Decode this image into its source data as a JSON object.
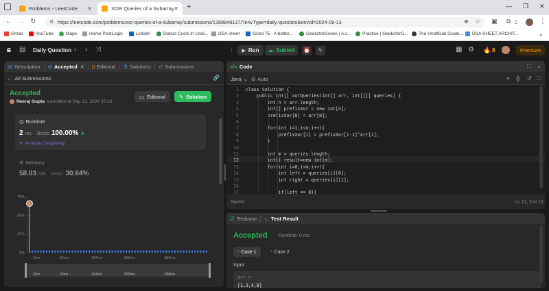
{
  "browser": {
    "tabs": [
      {
        "label": "Problems - LeetCode"
      },
      {
        "label": "XOR Queries of a Subarray - Le"
      }
    ],
    "url": "https://leetcode.com/problems/xor-queries-of-a-subarray/submissions/1388848137/?envType=daily-question&envId=2024-09-13",
    "bookmarks": [
      "Gmail",
      "YouTube",
      "Maps",
      "Home PostLogin",
      "Linkdin",
      "Detect Cycle In Undi...",
      "DSA sheet",
      "Grind 75 - A better...",
      "GeeksforGeeks | A c...",
      "Practice | GeeksforG...",
      "The Unofficial Guide...",
      "DSA SHEET ARCHIT..."
    ]
  },
  "lcnav": {
    "daily": "Daily Question",
    "run": "Run",
    "submit": "Submit",
    "streak": "8",
    "premium": "Premium"
  },
  "left": {
    "tabs": [
      "Description",
      "Accepted",
      "Editorial",
      "Solutions",
      "Submissions"
    ],
    "all_submissions": "All Submissions",
    "status": "Accepted",
    "user": "Neeraj Gupta",
    "submitted_at": "submitted at Sep 13, 2024 20:10",
    "editorial_btn": "Editorial",
    "solution_btn": "Solution",
    "runtime_label": "Runtime",
    "runtime_value": "2",
    "runtime_unit": "ms",
    "beats_label": "Beats",
    "runtime_beats": "100.00%",
    "analyze": "Analyze Complexity",
    "memory_label": "Memory",
    "memory_value": "58.03",
    "memory_unit": "MB",
    "memory_beats": "30.64%"
  },
  "chart_data": {
    "type": "bar",
    "y_ticks": [
      "75%",
      "50%",
      "25%",
      "0%"
    ],
    "x_ticks": [
      "2ms",
      "20ms",
      "344ms",
      "559ms",
      "688ms"
    ],
    "ylim": [
      0,
      75
    ],
    "values": [
      62,
      3,
      3,
      3,
      3,
      3,
      3,
      3,
      3,
      3,
      3,
      3,
      3,
      3,
      3,
      3,
      3,
      3,
      3,
      3,
      3,
      3,
      3,
      3,
      3,
      3,
      3,
      3,
      3,
      3,
      3,
      3,
      3,
      3,
      3,
      3,
      3,
      3,
      3,
      3,
      3,
      3,
      3,
      3,
      3,
      3,
      3,
      3,
      3,
      3,
      3,
      3,
      3,
      3,
      3,
      3,
      3,
      3,
      3,
      3,
      3,
      3,
      3
    ],
    "bar_color": "#3b82f6"
  },
  "code": {
    "title": "Code",
    "lang": "Java",
    "auto": "Auto",
    "saved": "Saved",
    "cursor": "Ln 12, Col 15",
    "lines": [
      "class Solution {",
      "    public int[] xorQueries(int[] arr, int[][] queries) {",
      "        int n = arr.length;",
      "        int[] prefixXor = new int[n];",
      "        prefixXor[0] = arr[0];",
      "",
      "        for(int i=1;i<n;i++){",
      "            prefixXor[i] = prefixXor[i-1]^arr[i];",
      "        }",
      "",
      "        int m = queries.length;",
      "        int[] result=new int[m];",
      "        for(int i=0;i<m;i++){",
      "            int left = queries[i][0];",
      "            int right = queries[i][1];",
      "",
      "            if(left == 0){"
    ]
  },
  "result": {
    "tabs": [
      "Testcase",
      "Test Result"
    ],
    "status": "Accepted",
    "runtime": "Runtime: 0 ms",
    "cases": [
      "Case 1",
      "Case 2"
    ],
    "input_label": "Input",
    "var": "arr =",
    "arr_value": "[1,3,4,8]"
  }
}
